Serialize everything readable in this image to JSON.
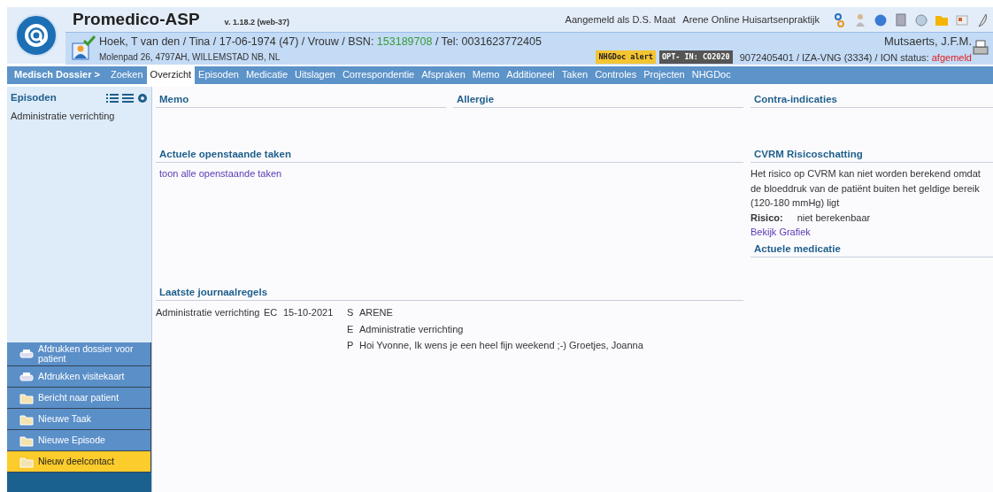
{
  "header": {
    "app_title": "Promedico-ASP",
    "version": "v. 1.18.2 (web-37)",
    "logged_in": "Aangemeld als D.S. Maat",
    "practice": "Arene Online Huisartsenpraktijk"
  },
  "patient": {
    "verified": true,
    "summary": "Hoek, T van den / Tina / 17-06-1974 (47) / Vrouw / BSN: ",
    "bsn": "153189708",
    "phone": " / Tel: 0031623772405",
    "address": "Molenpad 26, 4797AH, WILLEMSTAD NB, NL",
    "doctor": "Mutsaerts, J.F.M.",
    "badges": [
      {
        "label": "NHGDoc alert",
        "kind": "alert"
      },
      {
        "label": "OPT- IN: CO2020",
        "kind": "optin"
      }
    ],
    "ids": "9072405401 / IZA-VNG (3334) / ION status: ",
    "ion_status": "afgemeld"
  },
  "nav": {
    "breadcrumb": "Medisch Dossier >",
    "tabs": [
      {
        "label": "Zoeken",
        "selected": false
      },
      {
        "label": "Overzicht",
        "selected": true
      },
      {
        "label": "Episoden",
        "selected": false
      },
      {
        "label": "Medicatie",
        "selected": false
      },
      {
        "label": "Uitslagen",
        "selected": false
      },
      {
        "label": "Correspondentie",
        "selected": false
      },
      {
        "label": "Afspraken",
        "selected": false
      },
      {
        "label": "Memo",
        "selected": false
      },
      {
        "label": "Additioneel",
        "selected": false
      },
      {
        "label": "Taken",
        "selected": false
      },
      {
        "label": "Controles",
        "selected": false
      },
      {
        "label": "Projecten",
        "selected": false
      },
      {
        "label": "NHGDoc",
        "selected": false
      }
    ]
  },
  "sidebar": {
    "title": "Episoden",
    "items": [
      "Administratie verrichting"
    ],
    "actions": [
      {
        "label": "Afdrukken dossier voor patient",
        "kind": "print",
        "selected": false
      },
      {
        "label": "Afdrukken visitekaart",
        "kind": "print",
        "selected": false
      },
      {
        "label": "Bericht naar patient",
        "kind": "folder",
        "selected": false
      },
      {
        "label": "Nieuwe Taak",
        "kind": "folder",
        "selected": false
      },
      {
        "label": "Nieuwe Episode",
        "kind": "folder",
        "selected": false
      },
      {
        "label": "Nieuw deelcontact",
        "kind": "folder",
        "selected": true
      }
    ]
  },
  "overview": {
    "memo": {
      "title": "Memo"
    },
    "allergy": {
      "title": "Allergie"
    },
    "contra": {
      "title": "Contra-indicaties"
    },
    "tasks": {
      "title": "Actuele openstaande taken",
      "link": "toon alle openstaande taken"
    },
    "cvrm": {
      "title": "CVRM Risicoschatting",
      "text": "Het risico op CVRM kan niet worden berekend omdat de bloeddruk van de patiënt buiten het geldige bereik (120-180 mmHg) ligt",
      "risk_label": "Risico:",
      "risk_value": "niet berekenbaar",
      "link": "Bekijk Grafiek"
    },
    "journal": {
      "title": "Laatste journaalregels",
      "rows": [
        {
          "episode": "Administratie verrichting",
          "code": "EC",
          "date": "15-10-2021",
          "lines": [
            {
              "letter": "S",
              "text": "ARENE"
            },
            {
              "letter": "E",
              "text": "Administratie verrichting"
            },
            {
              "letter": "P",
              "text": "Hoi Yvonne, Ik wens je een heel fijn weekend ;-) Groetjes, Joanna"
            }
          ]
        }
      ]
    },
    "medication": {
      "title": "Actuele medicatie"
    }
  }
}
